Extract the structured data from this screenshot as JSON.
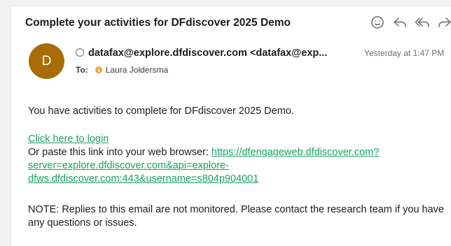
{
  "email": {
    "subject": "Complete your activities for DFdiscover 2025 Demo",
    "sender_initial": "D",
    "from": "datafax@explore.dfdiscover.com <datafax@exp...",
    "timestamp": "Yesterday at 1:47 PM",
    "to_label": "To:",
    "to_name": "Laura Joldersma",
    "body": {
      "intro": "You have activities to complete for DFdiscover 2025 Demo.",
      "login_link": "Click here to login",
      "paste_text": "Or paste this link into your web browser: ",
      "url_line1": "https://dfengageweb.dfdiscover.com?",
      "url_line2": "server=explore.dfdiscover.com&api=explore-",
      "url_line3": "dfws.dfdiscover.com:443&username=s804p904001",
      "note": "NOTE: Replies to this email are not monitored. Please contact the research team if you have any questions or issues."
    }
  },
  "toolbar": {
    "icons": [
      "smiley-icon",
      "reply-icon",
      "reply-all-icon",
      "forward-icon"
    ]
  },
  "colors": {
    "avatar": "#a86e05",
    "link": "#1aa260",
    "recipient_dot": "#f0a33a"
  }
}
